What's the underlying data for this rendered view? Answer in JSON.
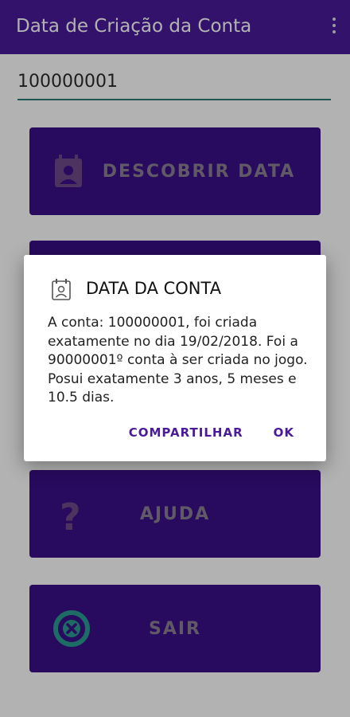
{
  "appbar": {
    "title": "Data de Criação da Conta",
    "overflow_icon": "more-vert-icon"
  },
  "input": {
    "value": "100000001"
  },
  "buttons": [
    {
      "label": "DESCOBRIR DATA",
      "icon": "calendar-person-icon"
    },
    {
      "label": "",
      "icon": ""
    },
    {
      "label": "AJUDA",
      "icon": "question-mark-icon"
    },
    {
      "label": "SAIR",
      "icon": "close-circle-icon"
    }
  ],
  "dialog": {
    "icon": "calendar-person-icon",
    "title": "DATA DA CONTA",
    "message": "A conta: 100000001, foi criada exatamente no dia 19/02/2018. Foi a 90000001º conta à ser criada no jogo. Posui exatamente 3 anos, 5 meses e 10.5 dias.",
    "share_label": "COMPARTILHAR",
    "ok_label": "OK"
  },
  "colors": {
    "primary": "#4a1a9a",
    "button": "#3a0f87",
    "accent": "#2a7c77",
    "exit_icon": "#2a9b93"
  }
}
